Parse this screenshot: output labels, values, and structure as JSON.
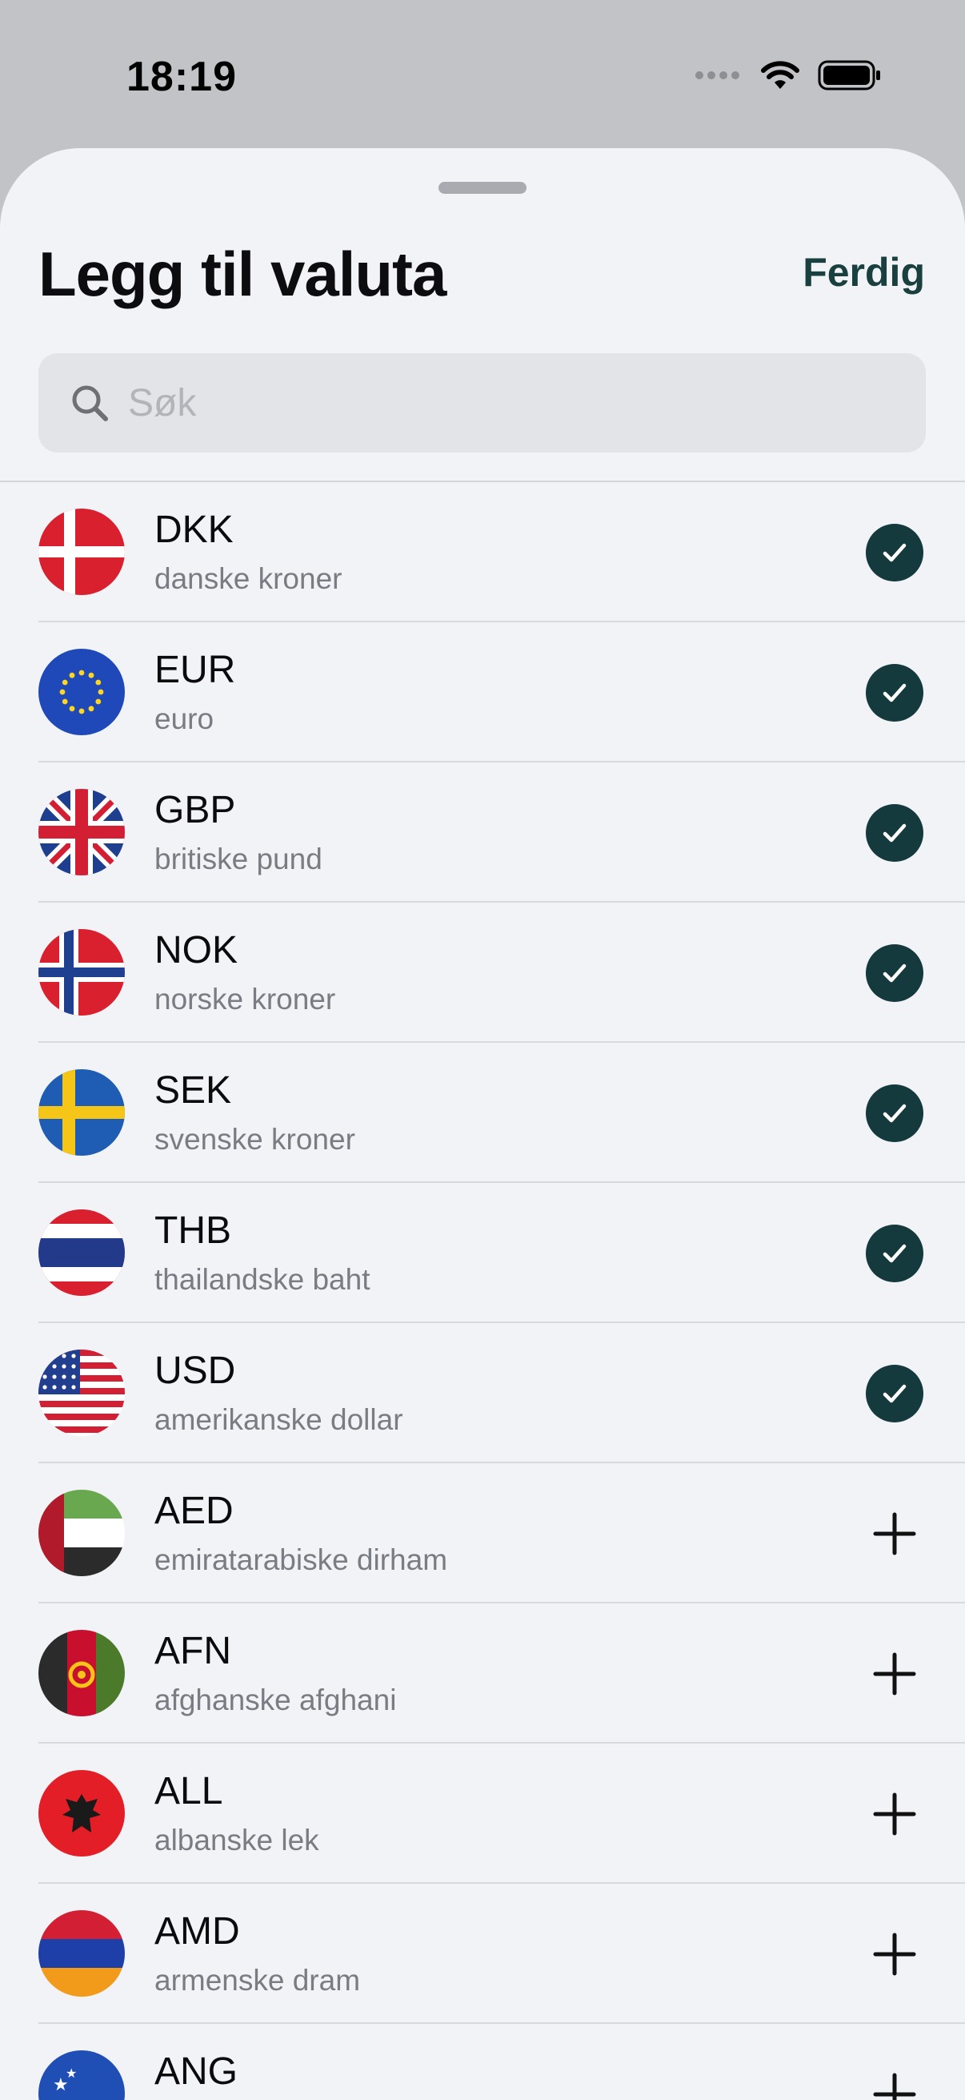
{
  "status": {
    "time": "18:19"
  },
  "sheet": {
    "title": "Legg til valuta",
    "done_label": "Ferdig"
  },
  "search": {
    "placeholder": "Søk",
    "value": ""
  },
  "colors": {
    "accent": "#143a3d",
    "done": "#1a3f3f",
    "sheet_bg": "#f2f3f7"
  },
  "currencies": [
    {
      "code": "DKK",
      "name": "danske kroner",
      "flag": "denmark-flag-icon",
      "selected": true
    },
    {
      "code": "EUR",
      "name": "euro",
      "flag": "eu-flag-icon",
      "selected": true
    },
    {
      "code": "GBP",
      "name": "britiske pund",
      "flag": "uk-flag-icon",
      "selected": true
    },
    {
      "code": "NOK",
      "name": "norske kroner",
      "flag": "norway-flag-icon",
      "selected": true
    },
    {
      "code": "SEK",
      "name": "svenske kroner",
      "flag": "sweden-flag-icon",
      "selected": true
    },
    {
      "code": "THB",
      "name": "thailandske baht",
      "flag": "thailand-flag-icon",
      "selected": true
    },
    {
      "code": "USD",
      "name": "amerikanske dollar",
      "flag": "usa-flag-icon",
      "selected": true
    },
    {
      "code": "AED",
      "name": "emiratarabiske dirham",
      "flag": "uae-flag-icon",
      "selected": false
    },
    {
      "code": "AFN",
      "name": "afghanske afghani",
      "flag": "afghanistan-flag-icon",
      "selected": false
    },
    {
      "code": "ALL",
      "name": "albanske lek",
      "flag": "albania-flag-icon",
      "selected": false
    },
    {
      "code": "AMD",
      "name": "armenske dram",
      "flag": "armenia-flag-icon",
      "selected": false
    },
    {
      "code": "ANG",
      "name": "",
      "flag": "curacao-flag-icon",
      "selected": false
    }
  ]
}
